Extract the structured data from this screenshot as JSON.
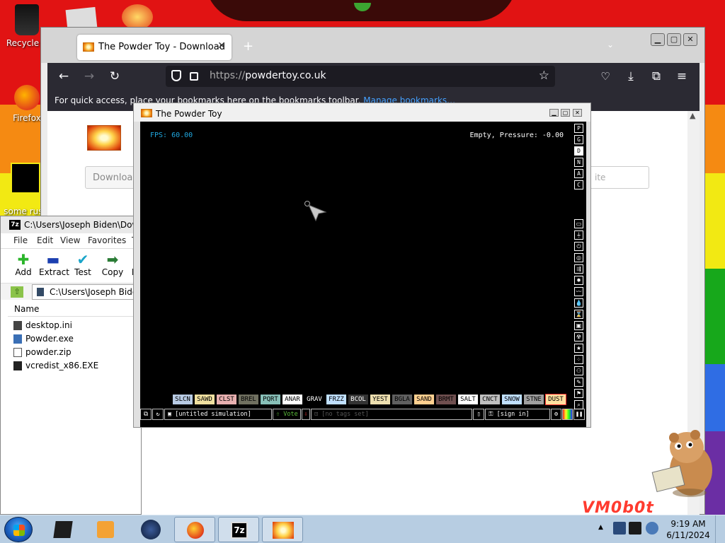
{
  "desktop": {
    "icons": [
      {
        "label": "Recycle B"
      },
      {
        "label": "Firefox"
      },
      {
        "label": "some russ\ntan a ra"
      }
    ],
    "stripe_colors": [
      "#e11313",
      "#f58a12",
      "#f2e913",
      "#17a81b",
      "#2f6de4",
      "#6b2ea4"
    ]
  },
  "firefox": {
    "tab_title": "The Powder Toy - Download",
    "tab_close_icon": "close-icon",
    "new_tab": "+",
    "url_prefix": "https://",
    "url_domain": "powdertoy.co.uk",
    "bookmarks_text": "For quick access, place your bookmarks here on the bookmarks toolbar.",
    "bookmarks_link": "Manage bookmarks…",
    "download_label": "Download",
    "search_fragment": "ite"
  },
  "sevenzip": {
    "title": "C:\\Users\\Joseph Biden\\Downloads",
    "menu": [
      "File",
      "Edit",
      "View",
      "Favorites",
      "T"
    ],
    "toolbar": [
      {
        "label": "Add",
        "glyph": "+",
        "color": "#2bb52b"
      },
      {
        "label": "Extract",
        "glyph": "▬",
        "color": "#1b3fb0"
      },
      {
        "label": "Test",
        "glyph": "✔",
        "color": "#1aa5c9"
      },
      {
        "label": "Copy",
        "glyph": "➡",
        "color": "#2a7b35"
      },
      {
        "label": "M",
        "glyph": "",
        "color": "#000"
      }
    ],
    "address": "C:\\Users\\Joseph Biden\\",
    "column_name": "Name",
    "files": [
      {
        "name": "desktop.ini",
        "icon": "ini-file-icon"
      },
      {
        "name": "Powder.exe",
        "icon": "exe-file-icon"
      },
      {
        "name": "powder.zip",
        "icon": "zip-file-icon"
      },
      {
        "name": "vcredist_x86.EXE",
        "icon": "exe-file-icon"
      }
    ]
  },
  "powdertoy": {
    "window_title": "The Powder Toy",
    "fps": "FPS: 60.00",
    "status": "Empty, Pressure: -0.00",
    "side_buttons": [
      "P",
      "G",
      "D",
      "N",
      "A",
      "C"
    ],
    "selected_side": "D",
    "tool_icons": [
      "wall-icon",
      "electronics-icon",
      "power-icon",
      "sensor-icon",
      "force-icon",
      "explosive-icon",
      "gas-icon",
      "liquid-icon",
      "powder-icon",
      "solid-icon",
      "radioactive-icon",
      "special-icon",
      "particles-icon",
      "life-icon",
      "tools-icon",
      "favorites-icon",
      "search-icon"
    ],
    "elements": [
      {
        "name": "SLCN",
        "bg": "#b8cbe4",
        "fg": "#000"
      },
      {
        "name": "SAWD",
        "bg": "#f0e0a0",
        "fg": "#000"
      },
      {
        "name": "CLST",
        "bg": "#e8b0b0",
        "fg": "#000"
      },
      {
        "name": "BREL",
        "bg": "#707060",
        "fg": "#000"
      },
      {
        "name": "PQRT",
        "bg": "#88c0b8",
        "fg": "#000"
      },
      {
        "name": "ANAR",
        "bg": "#ffffff",
        "fg": "#000"
      },
      {
        "name": "GRAV",
        "bg": "#000000",
        "fg": "#fff"
      },
      {
        "name": "FRZZ",
        "bg": "#c0e0ff",
        "fg": "#000"
      },
      {
        "name": "BCOL",
        "bg": "#333333",
        "fg": "#fff"
      },
      {
        "name": "YEST",
        "bg": "#eee0b0",
        "fg": "#000"
      },
      {
        "name": "BGLA",
        "bg": "#606060",
        "fg": "#000"
      },
      {
        "name": "SAND",
        "bg": "#ffd090",
        "fg": "#000"
      },
      {
        "name": "BRMT",
        "bg": "#705050",
        "fg": "#000"
      },
      {
        "name": "SALT",
        "bg": "#ffffff",
        "fg": "#000"
      },
      {
        "name": "CNCT",
        "bg": "#c0c0c0",
        "fg": "#000"
      },
      {
        "name": "SNOW",
        "bg": "#c0e0ff",
        "fg": "#000"
      },
      {
        "name": "STNE",
        "bg": "#a0a0a0",
        "fg": "#000"
      },
      {
        "name": "DUST",
        "bg": "#ffe0a0",
        "fg": "#000"
      }
    ],
    "selected_element": "DUST",
    "sim_name": "[untitled simulation]",
    "vote_label": "Vote",
    "tags": "[no tags set]",
    "signin": "[sign in]"
  },
  "watermark": "VM0b0t",
  "taskbar": {
    "apps": [
      "explorer-icon",
      "media-player-icon",
      "browser-icon",
      "firefox-icon",
      "7zip-icon",
      "powdertoy-icon"
    ],
    "active": [
      "firefox-icon",
      "7zip-icon",
      "powdertoy-icon"
    ],
    "time": "9:19 AM",
    "date": "6/11/2024"
  }
}
